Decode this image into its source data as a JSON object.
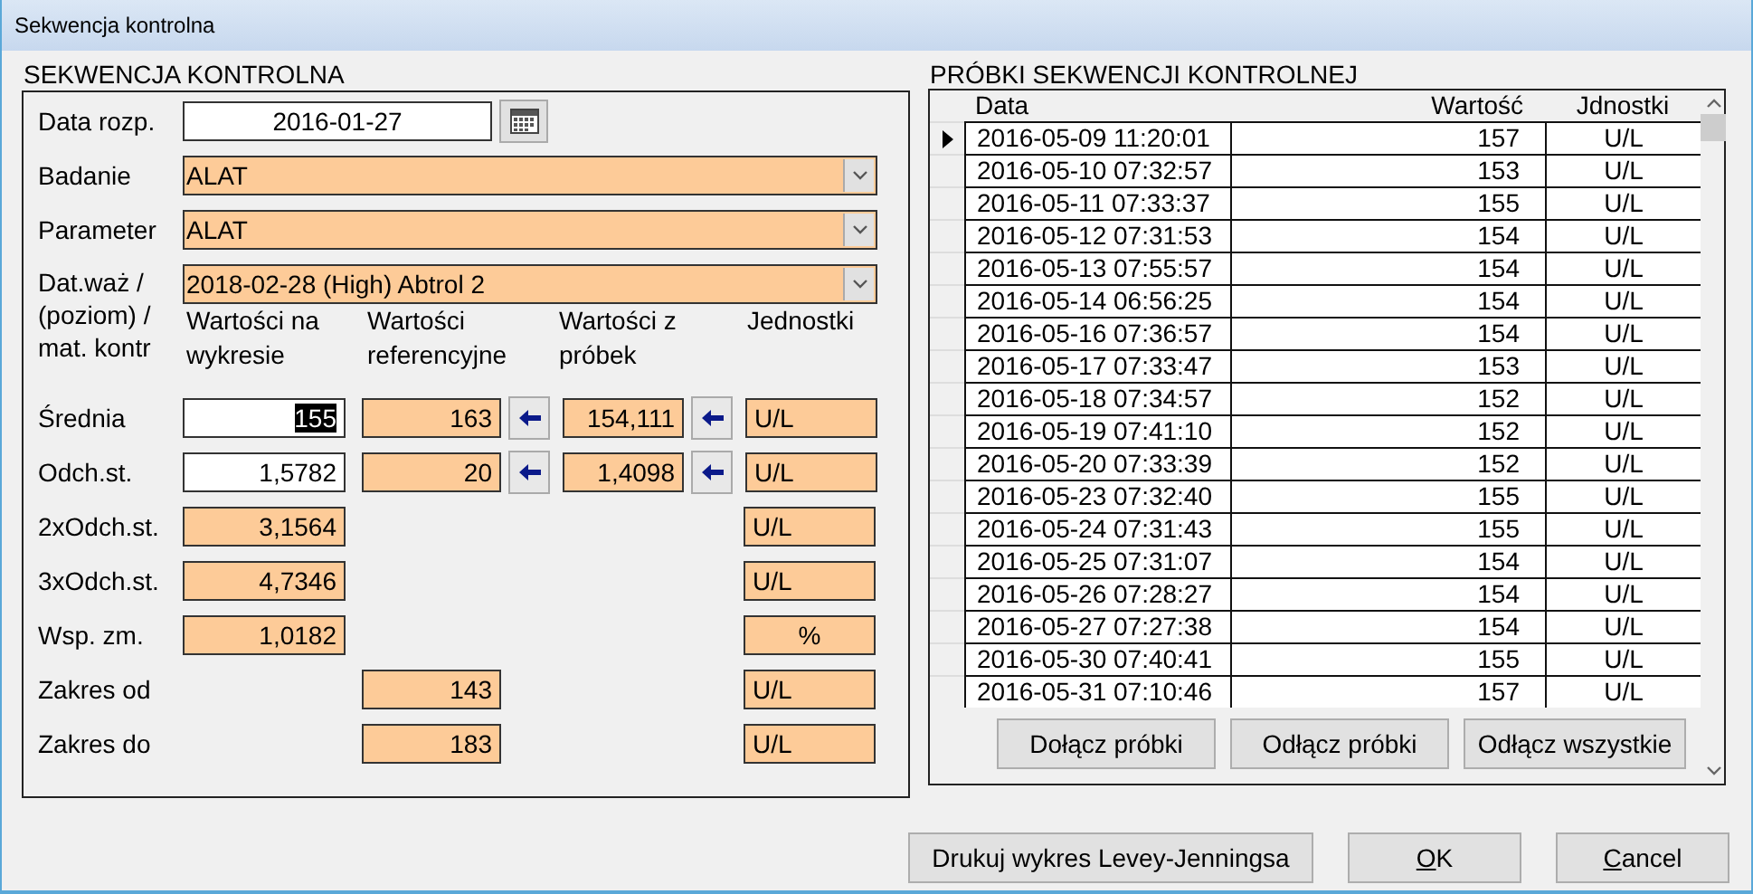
{
  "window": {
    "title": "Sekwencja kontrolna"
  },
  "left": {
    "title": "SEKWENCJA KONTROLNA",
    "date": {
      "label": "Data rozp.",
      "value": "2016-01-27"
    },
    "combos": [
      {
        "label": "Badanie",
        "value": "ALAT"
      },
      {
        "label": "Parameter",
        "value": "ALAT"
      },
      {
        "label": "Dat.waż / (poziom) / mat. kontr",
        "value": "2018-02-28 (High) Abtrol 2"
      }
    ],
    "column_headers": [
      "Wartości na wykresie",
      "Wartości referencyjne",
      "Wartości z próbek",
      "Jednostki"
    ],
    "rows": [
      {
        "label": "Średnia",
        "chart": {
          "value": "155",
          "editable": true,
          "highlighted": true
        },
        "reference": "163",
        "sample": "154,111",
        "unit": {
          "value": "U/L",
          "centered": false
        }
      },
      {
        "label": "Odch.st.",
        "chart": {
          "value": "1,5782",
          "editable": true,
          "highlighted": false
        },
        "reference": "20",
        "sample": "1,4098",
        "unit": {
          "value": "U/L",
          "centered": false
        }
      },
      {
        "label": "2xOdch.st.",
        "chart": {
          "value": "3,1564",
          "editable": false,
          "highlighted": false
        },
        "unit": {
          "value": "U/L",
          "centered": false
        }
      },
      {
        "label": "3xOdch.st.",
        "chart": {
          "value": "4,7346",
          "editable": false,
          "highlighted": false
        },
        "unit": {
          "value": "U/L",
          "centered": false
        }
      },
      {
        "label": "Wsp. zm.",
        "chart": {
          "value": "1,0182",
          "editable": false,
          "highlighted": false
        },
        "unit": {
          "value": "%",
          "centered": true
        }
      },
      {
        "label": "Zakres od",
        "reference": "143",
        "unit": {
          "value": "U/L",
          "centered": false
        }
      },
      {
        "label": "Zakres do",
        "reference": "183",
        "unit": {
          "value": "U/L",
          "centered": false
        }
      }
    ]
  },
  "samples": {
    "title": "PRÓBKI SEKWENCJI KONTROLNEJ",
    "columns": [
      "Data",
      "Wartość",
      "Jdnostki"
    ],
    "rows": [
      {
        "date": "2016-05-09 11:20:01",
        "value": "157",
        "unit": "U/L",
        "selected": true
      },
      {
        "date": "2016-05-10 07:32:57",
        "value": "153",
        "unit": "U/L",
        "selected": false
      },
      {
        "date": "2016-05-11 07:33:37",
        "value": "155",
        "unit": "U/L",
        "selected": false
      },
      {
        "date": "2016-05-12 07:31:53",
        "value": "154",
        "unit": "U/L",
        "selected": false
      },
      {
        "date": "2016-05-13 07:55:57",
        "value": "154",
        "unit": "U/L",
        "selected": false
      },
      {
        "date": "2016-05-14 06:56:25",
        "value": "154",
        "unit": "U/L",
        "selected": false
      },
      {
        "date": "2016-05-16 07:36:57",
        "value": "154",
        "unit": "U/L",
        "selected": false
      },
      {
        "date": "2016-05-17 07:33:47",
        "value": "153",
        "unit": "U/L",
        "selected": false
      },
      {
        "date": "2016-05-18 07:34:57",
        "value": "152",
        "unit": "U/L",
        "selected": false
      },
      {
        "date": "2016-05-19 07:41:10",
        "value": "152",
        "unit": "U/L",
        "selected": false
      },
      {
        "date": "2016-05-20 07:33:39",
        "value": "152",
        "unit": "U/L",
        "selected": false
      },
      {
        "date": "2016-05-23 07:32:40",
        "value": "155",
        "unit": "U/L",
        "selected": false
      },
      {
        "date": "2016-05-24 07:31:43",
        "value": "155",
        "unit": "U/L",
        "selected": false
      },
      {
        "date": "2016-05-25 07:31:07",
        "value": "154",
        "unit": "U/L",
        "selected": false
      },
      {
        "date": "2016-05-26 07:28:27",
        "value": "154",
        "unit": "U/L",
        "selected": false
      },
      {
        "date": "2016-05-27 07:27:38",
        "value": "154",
        "unit": "U/L",
        "selected": false
      },
      {
        "date": "2016-05-30 07:40:41",
        "value": "155",
        "unit": "U/L",
        "selected": false
      },
      {
        "date": "2016-05-31 07:10:46",
        "value": "157",
        "unit": "U/L",
        "selected": false
      }
    ],
    "buttons": [
      "Dołącz próbki",
      "Odłącz próbki",
      "Odłącz wszystkie"
    ]
  },
  "footer_buttons": [
    {
      "label": "Drukuj wykres Levey-Jenningsa",
      "underline_first": false
    },
    {
      "label": "OK",
      "underline_first": true
    },
    {
      "label": "Cancel",
      "underline_first": true
    }
  ]
}
